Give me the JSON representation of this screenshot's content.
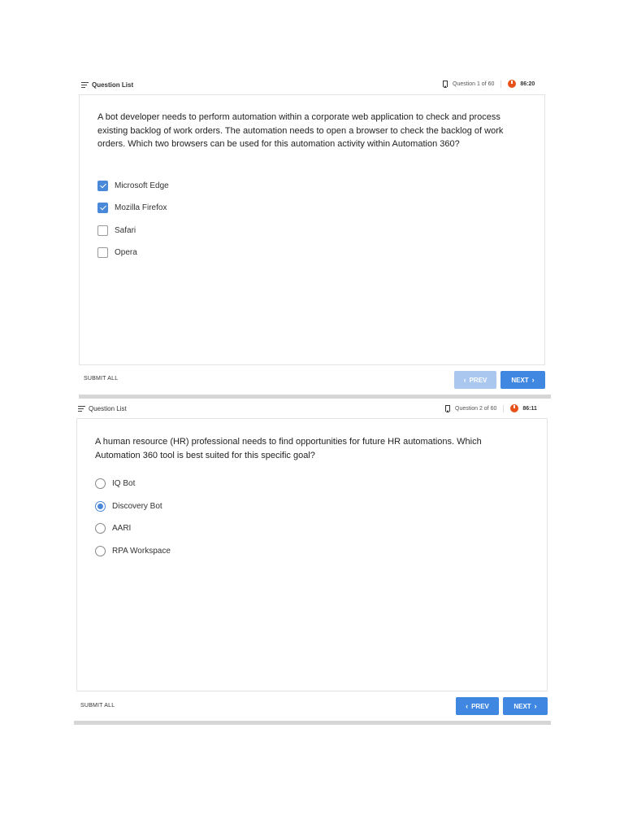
{
  "questions": [
    {
      "question_list_label": "Question List",
      "counter": "Question 1 of 60",
      "timer": "86:20",
      "text": "A bot developer needs to perform automation within a corporate web application to check and process existing backlog of work orders. The automation needs to open a browser to check the backlog of work orders. Which two browsers can be used for this automation activity within Automation 360?",
      "type": "checkbox",
      "options": [
        {
          "label": "Microsoft Edge",
          "checked": true
        },
        {
          "label": "Mozilla Firefox",
          "checked": true
        },
        {
          "label": "Safari",
          "checked": false
        },
        {
          "label": "Opera",
          "checked": false
        }
      ],
      "submit_label": "SUBMIT ALL",
      "prev_label": "PREV",
      "next_label": "NEXT"
    },
    {
      "question_list_label": "Question List",
      "counter": "Question 2 of 60",
      "timer": "86:11",
      "text": "A human resource (HR) professional needs to find opportunities for future HR automations. Which Automation 360 tool is best suited for this specific goal?",
      "type": "radio",
      "options": [
        {
          "label": "IQ Bot",
          "checked": false
        },
        {
          "label": "Discovery Bot",
          "checked": true
        },
        {
          "label": "AARI",
          "checked": false
        },
        {
          "label": "RPA Workspace",
          "checked": false
        }
      ],
      "submit_label": "SUBMIT ALL",
      "prev_label": "PREV",
      "next_label": "NEXT"
    }
  ],
  "colors": {
    "accent": "#3f87e0",
    "accent_disabled": "#a9c7ef",
    "timer": "#e8511a"
  },
  "icons": {
    "list": "list-icon",
    "bookmark": "bookmark-icon",
    "timer": "timer-icon",
    "prev": "chevron-left-icon",
    "next": "chevron-right-icon"
  }
}
